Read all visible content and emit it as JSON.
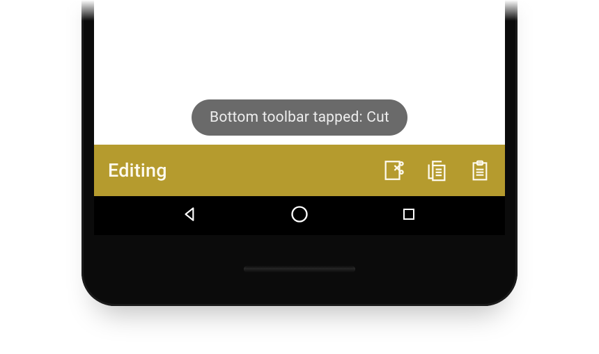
{
  "toast": {
    "text": "Bottom toolbar tapped: Cut"
  },
  "toolbar": {
    "title": "Editing",
    "actions": {
      "cut": "Cut",
      "copy": "Copy",
      "paste": "Paste"
    }
  },
  "navbar": {
    "back": "Back",
    "home": "Home",
    "recents": "Recents"
  },
  "colors": {
    "toolbar_bg": "#b59b2e",
    "toast_bg": "#6a6a6a"
  }
}
